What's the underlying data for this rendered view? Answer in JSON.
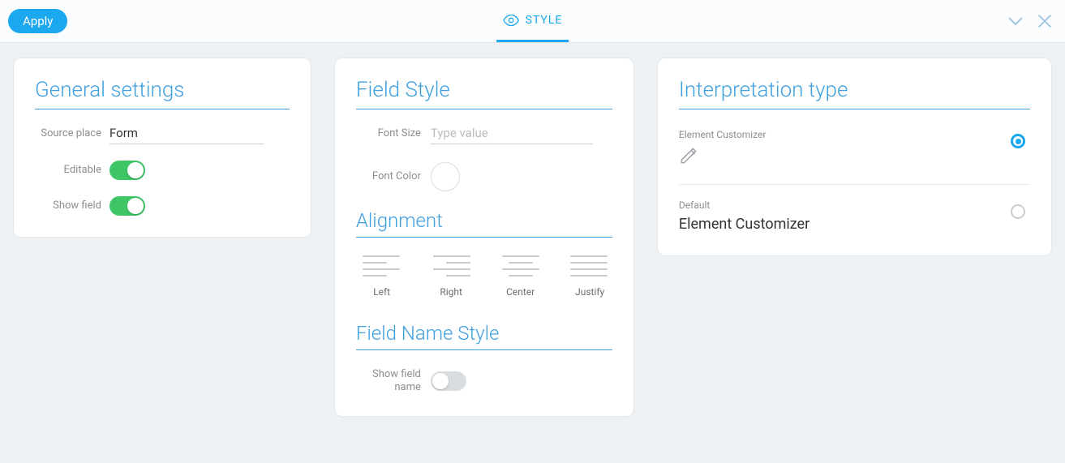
{
  "topbar": {
    "apply_label": "Apply",
    "tab_label": "STYLE"
  },
  "general": {
    "heading": "General settings",
    "source_label": "Source place",
    "source_value": "Form",
    "editable_label": "Editable",
    "editable_on": true,
    "showfield_label": "Show field",
    "showfield_on": true
  },
  "fieldstyle": {
    "heading": "Field Style",
    "fontsize_label": "Font Size",
    "fontsize_placeholder": "Type value",
    "fontsize_value": "",
    "fontcolor_label": "Font Color",
    "alignment_heading": "Alignment",
    "align": {
      "left": "Left",
      "right": "Right",
      "center": "Center",
      "justify": "Justify"
    },
    "fieldname_heading": "Field Name Style",
    "showfieldname_label": "Show field name",
    "showfieldname_on": false
  },
  "interpretation": {
    "heading": "Interpretation type",
    "opt1": {
      "title": "Element Customizer",
      "selected": true
    },
    "opt2": {
      "hint": "Default",
      "title": "Element Customizer",
      "selected": false
    }
  }
}
